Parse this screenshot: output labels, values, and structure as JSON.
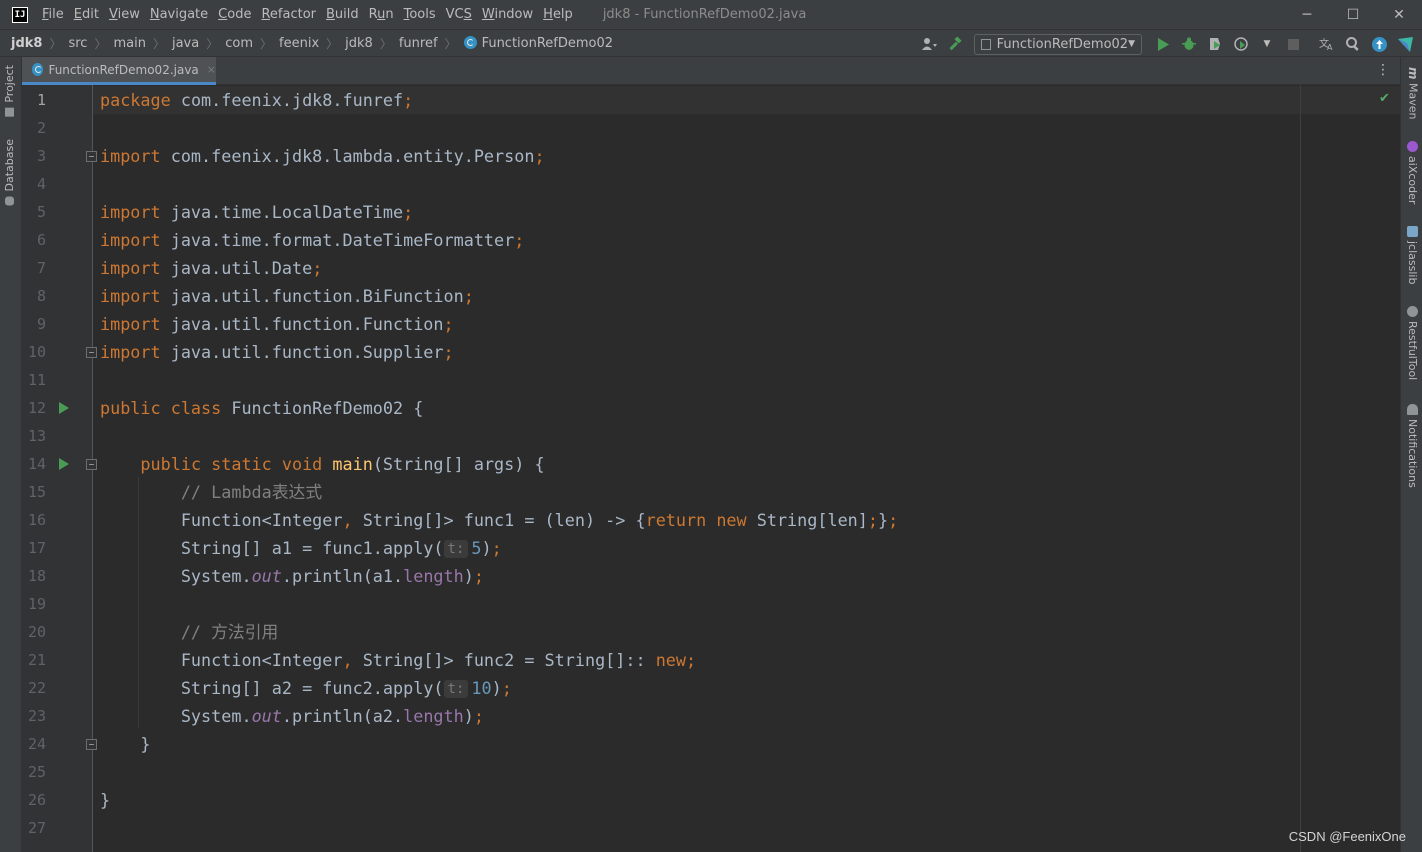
{
  "titlebar": {
    "logo_text": "IJ",
    "menu": [
      "File",
      "Edit",
      "View",
      "Navigate",
      "Code",
      "Refactor",
      "Build",
      "Run",
      "Tools",
      "VCS",
      "Window",
      "Help"
    ],
    "menu_mnemonics": [
      "F",
      "E",
      "V",
      "N",
      "C",
      "R",
      "B",
      "u",
      "T",
      "S",
      "W",
      "H"
    ],
    "window_title": "jdk8 - FunctionRefDemo02.java",
    "minimize": "─",
    "maximize": "☐",
    "close": "✕"
  },
  "breadcrumbs": [
    "jdk8",
    "src",
    "main",
    "java",
    "com",
    "feenix",
    "jdk8",
    "funref",
    "FunctionRefDemo02"
  ],
  "toolbar": {
    "run_config": "FunctionRefDemo02",
    "icons": [
      "user-icon",
      "build-hammer-icon",
      "run-icon",
      "debug-icon",
      "coverage-icon",
      "profile-icon",
      "stop-icon",
      "translate-icon",
      "search-icon",
      "update-icon",
      "plugin-icon"
    ]
  },
  "left_tool_windows": [
    "Project",
    "Database"
  ],
  "right_tool_windows": [
    "Maven",
    "aiXcoder",
    "jclasslib",
    "RestfulTool",
    "Notifications"
  ],
  "editor_tab": {
    "label": "FunctionRefDemo02.java",
    "close": "×"
  },
  "editor": {
    "current_line": 1,
    "lines": [
      {
        "n": "1",
        "tokens": [
          [
            "kw",
            "package"
          ],
          [
            "t",
            " com.feenix.jdk8.funref"
          ],
          [
            "kw",
            ";"
          ]
        ]
      },
      {
        "n": "2",
        "tokens": []
      },
      {
        "n": "3",
        "tokens": [
          [
            "kw",
            "import"
          ],
          [
            "t",
            " com.feenix.jdk8.lambda.entity.Person"
          ],
          [
            "kw",
            ";"
          ]
        ]
      },
      {
        "n": "4",
        "tokens": []
      },
      {
        "n": "5",
        "tokens": [
          [
            "kw",
            "import"
          ],
          [
            "t",
            " java.time.LocalDateTime"
          ],
          [
            "kw",
            ";"
          ]
        ]
      },
      {
        "n": "6",
        "tokens": [
          [
            "kw",
            "import"
          ],
          [
            "t",
            " java.time.format.DateTimeFormatter"
          ],
          [
            "kw",
            ";"
          ]
        ]
      },
      {
        "n": "7",
        "tokens": [
          [
            "kw",
            "import"
          ],
          [
            "t",
            " java.util.Date"
          ],
          [
            "kw",
            ";"
          ]
        ]
      },
      {
        "n": "8",
        "tokens": [
          [
            "kw",
            "import"
          ],
          [
            "t",
            " java.util.function.BiFunction"
          ],
          [
            "kw",
            ";"
          ]
        ]
      },
      {
        "n": "9",
        "tokens": [
          [
            "kw",
            "import"
          ],
          [
            "t",
            " java.util.function.Function"
          ],
          [
            "kw",
            ";"
          ]
        ]
      },
      {
        "n": "10",
        "tokens": [
          [
            "kw",
            "import"
          ],
          [
            "t",
            " java.util.function.Supplier"
          ],
          [
            "kw",
            ";"
          ]
        ]
      },
      {
        "n": "11",
        "tokens": []
      },
      {
        "n": "12",
        "tokens": [
          [
            "kw",
            "public class"
          ],
          [
            "t",
            " FunctionRefDemo02 {"
          ]
        ]
      },
      {
        "n": "13",
        "tokens": []
      },
      {
        "n": "14",
        "tokens": [
          [
            "t",
            "    "
          ],
          [
            "kw",
            "public static void"
          ],
          [
            "t",
            " "
          ],
          [
            "fn",
            "main"
          ],
          [
            "t",
            "(String[] args) {"
          ]
        ]
      },
      {
        "n": "15",
        "tokens": [
          [
            "t",
            "        "
          ],
          [
            "cm",
            "// Lambda表达式"
          ]
        ]
      },
      {
        "n": "16",
        "tokens": [
          [
            "t",
            "        Function<Integer"
          ],
          [
            "kw",
            ","
          ],
          [
            "t",
            " String[]> func1 = (len) -> {"
          ],
          [
            "kw",
            "return new"
          ],
          [
            "t",
            " String[len]"
          ],
          [
            "kw",
            ";"
          ],
          [
            "t",
            "}"
          ],
          [
            "kw",
            ";"
          ]
        ]
      },
      {
        "n": "17",
        "tokens": [
          [
            "t",
            "        String[] a1 = func1.apply("
          ],
          [
            "hint",
            "t:"
          ],
          [
            "num",
            "5"
          ],
          [
            "t",
            ")"
          ],
          [
            "kw",
            ";"
          ]
        ]
      },
      {
        "n": "18",
        "tokens": [
          [
            "t",
            "        System."
          ],
          [
            "sfld",
            "out"
          ],
          [
            "t",
            ".println(a1."
          ],
          [
            "fld",
            "length"
          ],
          [
            "t",
            ")"
          ],
          [
            "kw",
            ";"
          ]
        ]
      },
      {
        "n": "19",
        "tokens": []
      },
      {
        "n": "20",
        "tokens": [
          [
            "t",
            "        "
          ],
          [
            "cm",
            "// 方法引用"
          ]
        ]
      },
      {
        "n": "21",
        "tokens": [
          [
            "t",
            "        Function<Integer"
          ],
          [
            "kw",
            ","
          ],
          [
            "t",
            " String[]> func2 = String[]:: "
          ],
          [
            "kw",
            "new;"
          ]
        ]
      },
      {
        "n": "22",
        "tokens": [
          [
            "t",
            "        String[] a2 = func2.apply("
          ],
          [
            "hint",
            "t:"
          ],
          [
            "num",
            "10"
          ],
          [
            "t",
            ")"
          ],
          [
            "kw",
            ";"
          ]
        ]
      },
      {
        "n": "23",
        "tokens": [
          [
            "t",
            "        System."
          ],
          [
            "sfld",
            "out"
          ],
          [
            "t",
            ".println(a2."
          ],
          [
            "fld",
            "length"
          ],
          [
            "t",
            ")"
          ],
          [
            "kw",
            ";"
          ]
        ]
      },
      {
        "n": "24",
        "tokens": [
          [
            "t",
            "    }"
          ]
        ]
      },
      {
        "n": "25",
        "tokens": []
      },
      {
        "n": "26",
        "tokens": [
          [
            "t",
            "}"
          ]
        ]
      },
      {
        "n": "27",
        "tokens": []
      }
    ],
    "run_markers": [
      12,
      14
    ],
    "fold_markers": [
      3,
      10,
      14,
      24
    ]
  },
  "watermark": "CSDN @FeenixOne",
  "colors": {
    "keyword": "#cc7832",
    "comment": "#808080",
    "number": "#6897bb",
    "field": "#9876aa",
    "method": "#ffc66d",
    "text": "#a9b7c6",
    "accent": "#4a88c7"
  }
}
